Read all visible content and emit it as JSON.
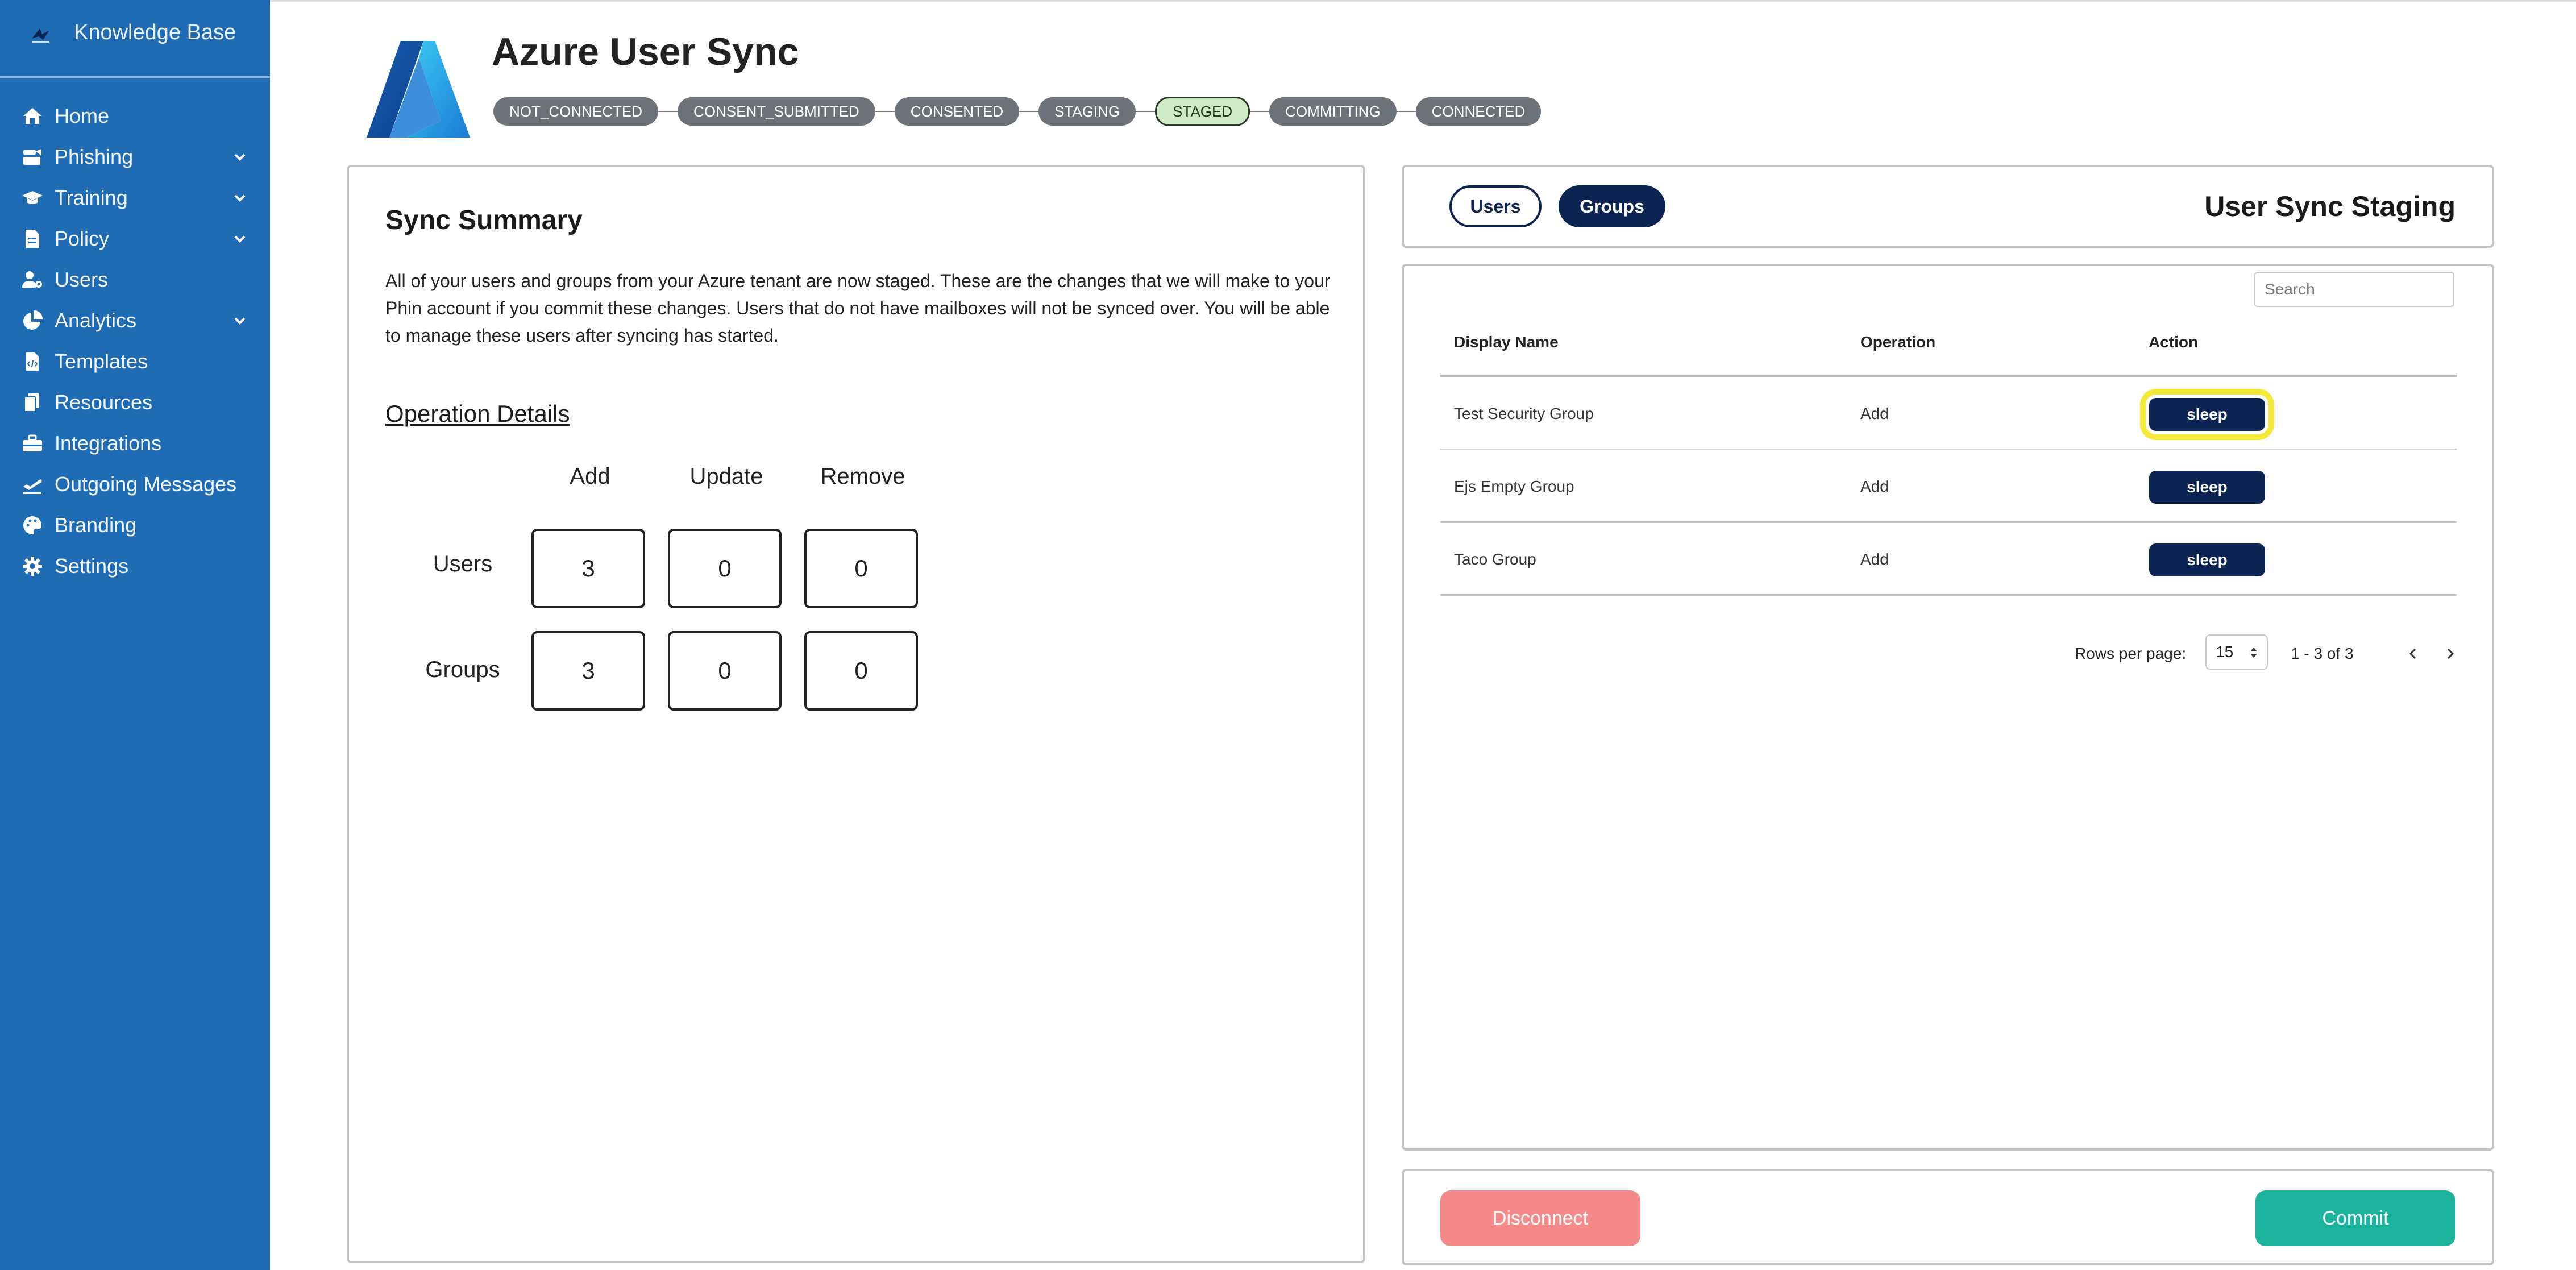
{
  "brand": {
    "name": "Knowledge Base"
  },
  "sidebar": {
    "items": [
      {
        "label": "Home",
        "icon": "home-icon"
      },
      {
        "label": "Phishing",
        "icon": "phishing-icon",
        "expandable": true
      },
      {
        "label": "Training",
        "icon": "graduation-cap-icon",
        "expandable": true
      },
      {
        "label": "Policy",
        "icon": "document-icon",
        "expandable": true
      },
      {
        "label": "Users",
        "icon": "users-gear-icon"
      },
      {
        "label": "Analytics",
        "icon": "pie-chart-icon",
        "expandable": true
      },
      {
        "label": "Templates",
        "icon": "code-file-icon"
      },
      {
        "label": "Resources",
        "icon": "copy-icon"
      },
      {
        "label": "Integrations",
        "icon": "toolbox-icon"
      },
      {
        "label": "Outgoing Messages",
        "icon": "plane-departure-icon"
      },
      {
        "label": "Branding",
        "icon": "palette-icon"
      },
      {
        "label": "Settings",
        "icon": "gear-icon"
      }
    ]
  },
  "header": {
    "title": "Azure User Sync",
    "steps": [
      "NOT_CONNECTED",
      "CONSENT_SUBMITTED",
      "CONSENTED",
      "STAGING",
      "STAGED",
      "COMMITTING",
      "CONNECTED"
    ],
    "active_step": "STAGED"
  },
  "summary": {
    "title": "Sync Summary",
    "text": "All of your users and groups from your Azure tenant are now staged. These are the changes that we will make to your Phin account if you commit these changes. Users that do not have mailboxes will not be synced over. You will be able to manage these users after syncing has started.",
    "operation_title": "Operation Details",
    "columns": [
      "Add",
      "Update",
      "Remove"
    ],
    "rows": [
      {
        "label": "Users",
        "values": [
          "3",
          "0",
          "0"
        ]
      },
      {
        "label": "Groups",
        "values": [
          "3",
          "0",
          "0"
        ]
      }
    ]
  },
  "staging": {
    "title": "User Sync Staging",
    "tabs": [
      "Users",
      "Groups"
    ],
    "active_tab": "Groups",
    "search_placeholder": "Search",
    "columns": [
      "Display Name",
      "Operation",
      "Action"
    ],
    "rows": [
      {
        "name": "Test Security Group",
        "operation": "Add",
        "action": "sleep"
      },
      {
        "name": "Ejs Empty Group",
        "operation": "Add",
        "action": "sleep"
      },
      {
        "name": "Taco Group",
        "operation": "Add",
        "action": "sleep"
      }
    ],
    "rows_per_page_label": "Rows per page:",
    "rows_per_page": "15",
    "range_text": "1 - 3 of 3"
  },
  "actions": {
    "disconnect": "Disconnect",
    "commit": "Commit"
  },
  "colors": {
    "sidebar": "#1f6bb4",
    "navy": "#0c2451",
    "commit": "#1cb39e",
    "disconnect": "#f48a8a",
    "active_step": "#cfe9c4",
    "step": "#6d7178",
    "highlight": "#f4e93b"
  }
}
